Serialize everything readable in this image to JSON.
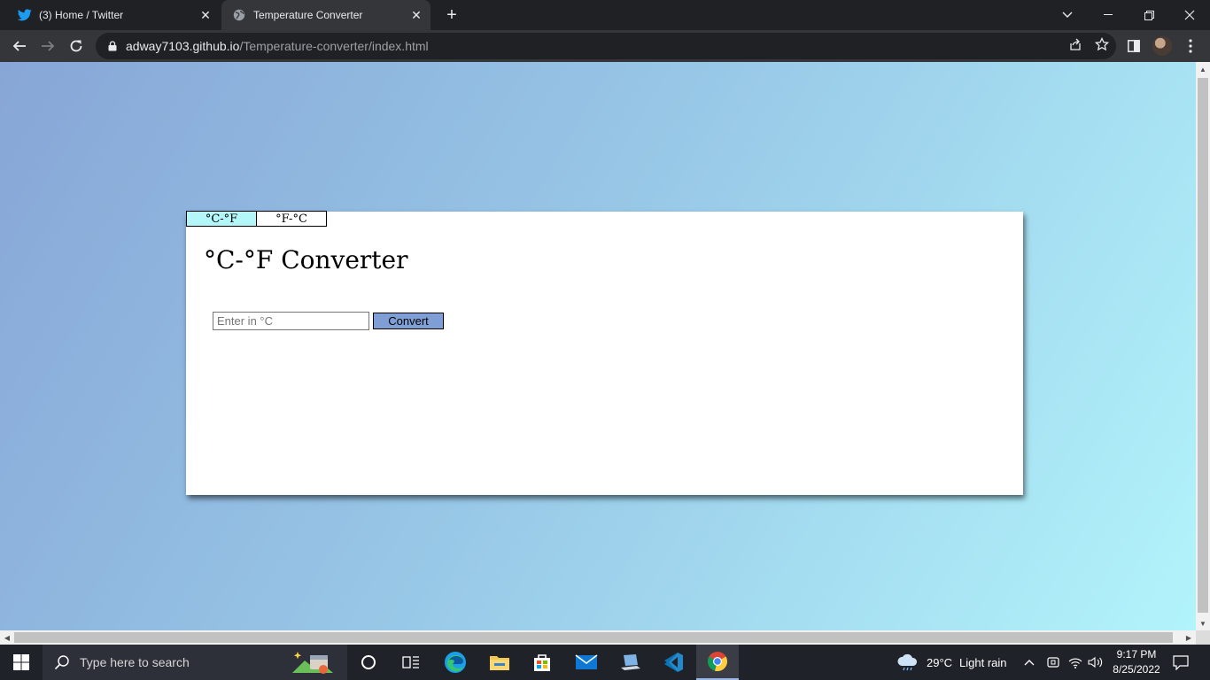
{
  "browser": {
    "tabs": [
      {
        "title": "(3) Home / Twitter",
        "active": false
      },
      {
        "title": "Temperature Converter",
        "active": true
      }
    ],
    "url_host": "adway7103.github.io",
    "url_path": "/Temperature-converter/index.html"
  },
  "page": {
    "tabs": [
      {
        "label": "°C-°F",
        "selected": true
      },
      {
        "label": "°F-°C",
        "selected": false
      }
    ],
    "heading": "°C-°F Converter",
    "input_placeholder": "Enter in °C",
    "input_value": "",
    "convert_label": "Convert"
  },
  "taskbar": {
    "search_placeholder": "Type here to search",
    "weather_temp": "29°C",
    "weather_desc": "Light rain",
    "time": "9:17 PM",
    "date": "8/25/2022"
  },
  "colors": {
    "page_gradient_start": "#87a6d6",
    "page_gradient_end": "#b2f4fb",
    "selected_tab": "#b4f7fb",
    "convert_button": "#7f9ed6"
  }
}
